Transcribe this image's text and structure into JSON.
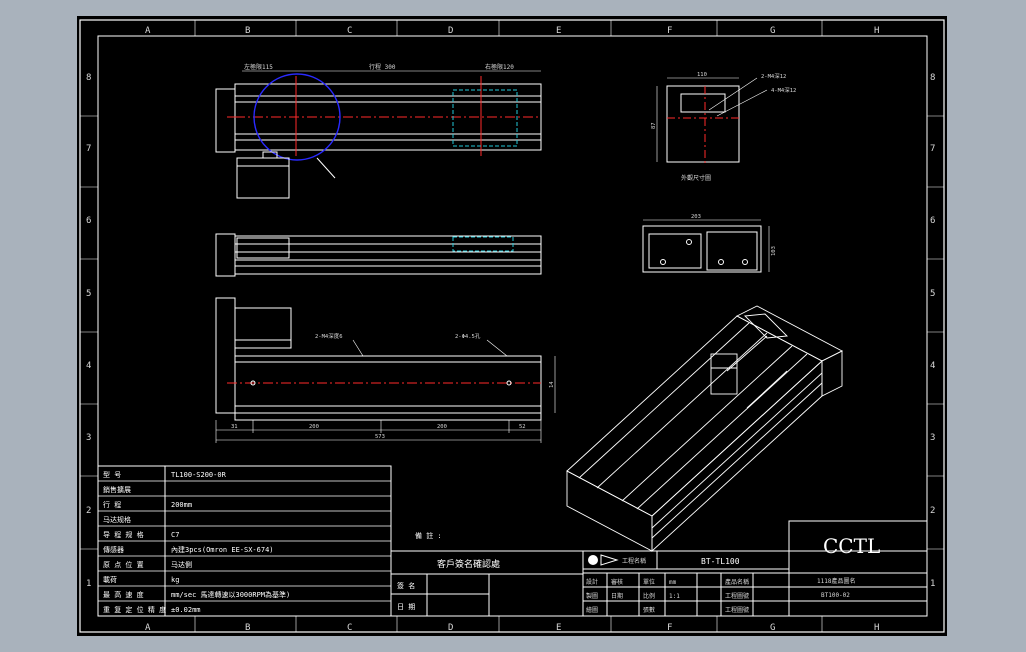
{
  "grid": {
    "columns": [
      "A",
      "B",
      "C",
      "D",
      "E",
      "F",
      "G",
      "H"
    ],
    "rows": [
      "8",
      "7",
      "6",
      "5",
      "4",
      "3",
      "2",
      "1"
    ]
  },
  "dims": {
    "left_travel": "左極限115",
    "travel": "行程 300",
    "right_travel": "右極限120",
    "width_110": "110",
    "height_87": "87",
    "hole_a": "2-M4深12",
    "hole_b": "4-M4深12",
    "end_view_note": "外觀尺寸圖",
    "side_width": "203",
    "side_height": "103",
    "rail_note": "2-M4深度6",
    "mount_note": "2-Φ4.5孔",
    "seg_left": "31",
    "seg_a": "200",
    "seg_b": "200",
    "seg_right": "52",
    "total": "573",
    "side_dim": "14"
  },
  "spec_table": {
    "rows": [
      {
        "label": "型 号",
        "value": "TL100-S200-0R"
      },
      {
        "label": "銷售擴展",
        "value": ""
      },
      {
        "label": "行 程",
        "value": "200mm"
      },
      {
        "label": "马达规格",
        "value": ""
      },
      {
        "label": "导 程 规 格",
        "value": "C7"
      },
      {
        "label": "傳感器",
        "value": "內建3pcs(Omron EE-SX-674)"
      },
      {
        "label": "原 点 位 置",
        "value": "马达側"
      },
      {
        "label": "載荷",
        "value": "kg"
      },
      {
        "label": "最 高 速 度",
        "value": "mm/sec 馬達轉速以3000RPM為基準)"
      },
      {
        "label": "重 复 定 位 精 度",
        "value": "±0.02mm"
      }
    ]
  },
  "notes_label": "備 註 :",
  "confirm": {
    "title": "客戶簽名確認處",
    "sign_label": "簽 名",
    "date_label": "日 期"
  },
  "title_block": {
    "company_label": "工程名稱",
    "drawing_title": "BT-TL100",
    "logo_text": "CCTL",
    "product_label": "1118產品圖名",
    "drawing_no": "BT100-02",
    "rows": [
      [
        "設計",
        "審核",
        "單位",
        "mm",
        "產品名稱"
      ],
      [
        "製圖",
        "日期",
        "比例",
        "1:1",
        "工程圖號"
      ],
      [
        "繪圖",
        "",
        "張數",
        "",
        "工程圖號"
      ]
    ]
  },
  "colors": {
    "background": "#a9b2bc",
    "sheet": "#000000",
    "line": "#ffffff",
    "center_line": "#ff2a2a",
    "circle": "#2a2aff",
    "hidden": "#22c8d8"
  }
}
